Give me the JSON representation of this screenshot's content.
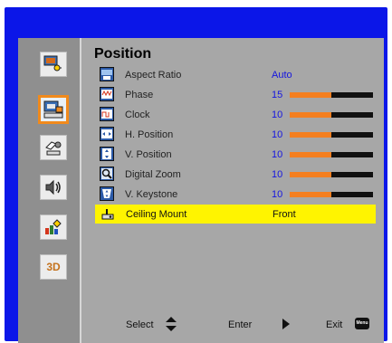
{
  "title": "Position",
  "side_menu": [
    {
      "name": "image-settings-icon",
      "active": false
    },
    {
      "name": "display-position-icon",
      "active": true
    },
    {
      "name": "setup-icon",
      "active": false
    },
    {
      "name": "audio-icon",
      "active": false
    },
    {
      "name": "options-icon",
      "active": false
    },
    {
      "name": "3d-icon",
      "active": false,
      "label": "3D"
    }
  ],
  "items": [
    {
      "label": "Aspect Ratio",
      "value": "Auto"
    },
    {
      "label": "Phase",
      "value": "15",
      "level": 0.5
    },
    {
      "label": "Clock",
      "value": "10",
      "level": 0.5
    },
    {
      "label": "H. Position",
      "value": "10",
      "level": 0.5
    },
    {
      "label": "V. Position",
      "value": "10",
      "level": 0.5
    },
    {
      "label": "Digital Zoom",
      "value": "10",
      "level": 0.5
    },
    {
      "label": "V. Keystone",
      "value": "10",
      "level": 0.5
    },
    {
      "label": "Ceiling Mount",
      "value": "Front",
      "selected": true
    }
  ],
  "footer": {
    "select": "Select",
    "enter": "Enter",
    "exit": "Exit",
    "menu_key": "Menu"
  },
  "colors": {
    "frame": "#0b16e8",
    "highlight": "#fff400",
    "bar_fill": "#f47f20",
    "value_text": "#1515e0"
  }
}
